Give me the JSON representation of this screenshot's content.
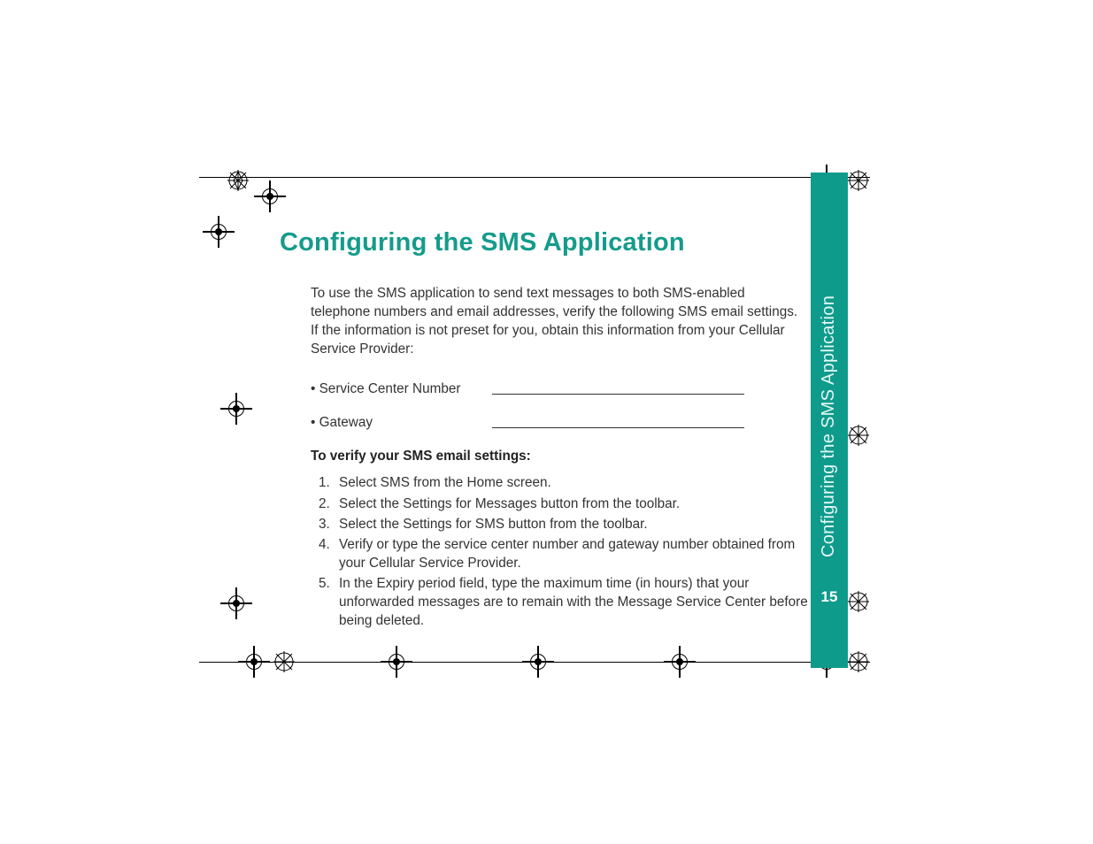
{
  "title": "Configuring the SMS Application",
  "intro": "To use the SMS application to send text messages to both SMS-enabled telephone numbers and email addresses, verify  the following SMS email settings. If the information is not preset for you, obtain this information  from your Cellular Service Provider:",
  "fields": [
    {
      "label": "• Service Center Number"
    },
    {
      "label": "• Gateway"
    }
  ],
  "subheading": "To verify your SMS email settings:",
  "steps": [
    "Select SMS from the Home screen.",
    "Select the Settings for Messages button from the toolbar.",
    "Select the Settings for SMS button from the toolbar.",
    "Verify or type the service center number and gateway number obtained from your Cellular Service Provider.",
    "In the Expiry period field, type the maximum time (in hours) that your unforwarded messages are to remain with the Message Service Center before being deleted."
  ],
  "sidebar": {
    "section_title": "Configuring the SMS Application",
    "page_number": "15"
  }
}
